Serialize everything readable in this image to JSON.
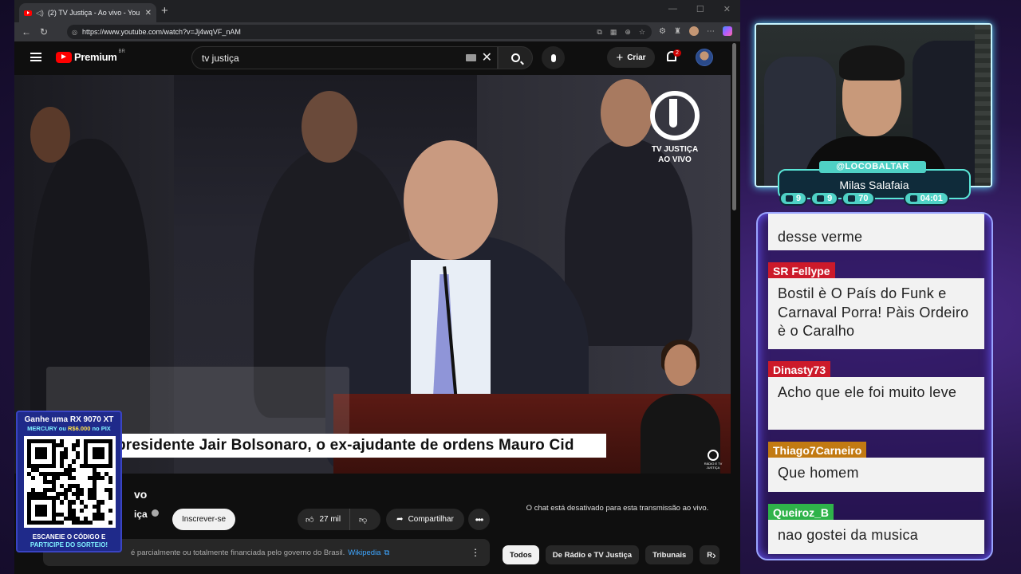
{
  "browser": {
    "tab_title": "(2) TV Justiça - Ao vivo - You",
    "url": "https://www.youtube.com/watch?v=Jj4wqVF_nAM"
  },
  "youtube": {
    "logo_text": "Premium",
    "country": "BR",
    "search_value": "tv justiça",
    "create_label": "Criar",
    "notifications": "2"
  },
  "video": {
    "caption": "presidente Jair Bolsonaro, o ex-ajudante de ordens Mauro Cid",
    "logo_line1": "TV JUSTIÇA",
    "logo_line2": "AO VIVO",
    "small_logo": "RÁDIO E TV JUSTIÇA",
    "title_fragment": "vo",
    "channel_fragment": "iça",
    "subscribe": "Inscrever-se",
    "likes": "27 mil",
    "share": "Compartilhar",
    "info_text": "é parcialmente ou totalmente financiada pelo governo do Brasil.",
    "info_link": "Wikipedia",
    "chat_disabled": "O chat está desativado para esta transmissão ao vivo.",
    "chips": [
      "Todos",
      "De Rádio e TV Justiça",
      "Tribunais"
    ]
  },
  "promo": {
    "line1": "Ganhe uma RX 9070 XT",
    "line2a": "MERCURY ou",
    "line2b": "R$6.000",
    "line2c": "no PIX",
    "line3": "ESCANEIE O CÓDIGO E",
    "line4": "PARTICIPE DO SORTEIO!"
  },
  "streamer": {
    "handle": "@LOCOBALTAR",
    "name": "Milas Salafaia",
    "stats": [
      "9",
      "9",
      "70",
      "04:01"
    ]
  },
  "chat": [
    {
      "user": "",
      "text": "desse verme",
      "color": "#cc1a2a"
    },
    {
      "user": "SR Fellype",
      "text": "Bostil è O País do Funk e Carnaval Porra! Pàis Ordeiro è o Caralho",
      "color": "#cc1a2a"
    },
    {
      "user": "Dinasty73",
      "text": "Acho que ele foi muito leve",
      "color": "#cc1a2a"
    },
    {
      "user": "Thiago7Carneiro",
      "text": "Que homem",
      "color": "#c27a12"
    },
    {
      "user": "Queiroz_B",
      "text": "nao gostei da musica",
      "color": "#2fb34a"
    }
  ]
}
